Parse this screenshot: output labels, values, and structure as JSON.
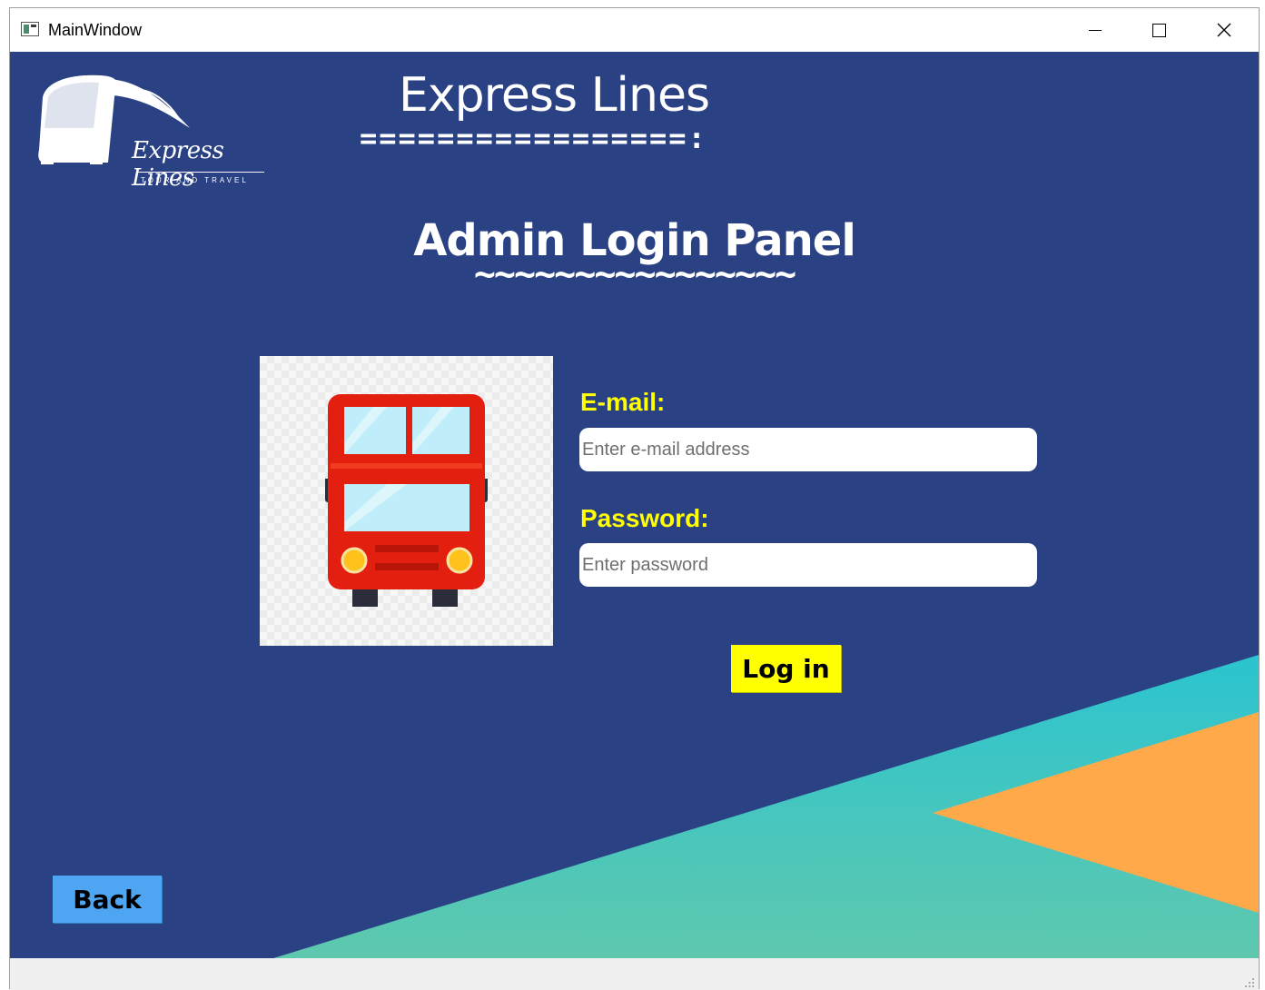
{
  "window": {
    "title": "MainWindow",
    "icons": {
      "app": "window-app-icon",
      "minimize": "minimize-icon",
      "maximize": "maximize-icon",
      "close": "close-icon"
    }
  },
  "brand": {
    "logo_text": "Express Lines",
    "logo_subtitle": "TOUR AND TRAVEL",
    "title": "Express Lines",
    "title_rule": "=================:"
  },
  "panel": {
    "title": "Admin Login Panel",
    "title_rule": "~~~~~~~~~~~~~~~~"
  },
  "form": {
    "email_label": "E-mail:",
    "email_placeholder": "Enter e-mail address",
    "email_value": "",
    "password_label": "Password:",
    "password_placeholder": "Enter password",
    "password_value": "",
    "login_label": "Log in"
  },
  "nav": {
    "back_label": "Back"
  },
  "colors": {
    "background": "#2a4184",
    "label": "#ffff00",
    "login_button": "#ffff00",
    "back_button": "#4ea6f2",
    "teal": "#2fc3cd",
    "orange": "#ffa94a",
    "bus_red": "#e3200f"
  }
}
